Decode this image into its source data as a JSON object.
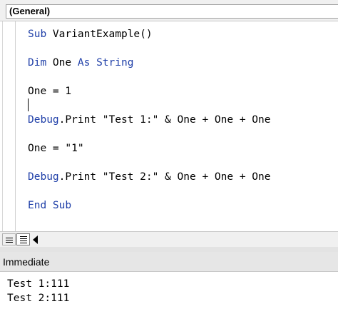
{
  "header": {
    "object_combo": "(General)"
  },
  "code": {
    "lines": [
      {
        "kw": "Sub",
        "rest": " VariantExample()"
      },
      {
        "kw": "Dim",
        "mid": " One ",
        "kw2": "As",
        "mid2": " ",
        "kw3": "String"
      },
      {
        "text": "One = 1"
      },
      {
        "kw": "Debug",
        "rest": ".Print \"Test 1:\" & One + One + One"
      },
      {
        "text": "One = \"1\""
      },
      {
        "kw": "Debug",
        "rest": ".Print \"Test 2:\" & One + One + One"
      },
      {
        "kw": "End Sub"
      }
    ]
  },
  "immediate": {
    "title": "Immediate",
    "output": [
      "Test 1:111",
      "Test 2:111"
    ]
  },
  "colors": {
    "keyword": "#1f3fa8",
    "toolbar_bg": "#f0f0f0"
  },
  "icons": {
    "procedure_view": "procedure-view-icon",
    "module_view": "full-module-view-icon",
    "scroll_left": "scroll-left-arrow-icon"
  }
}
